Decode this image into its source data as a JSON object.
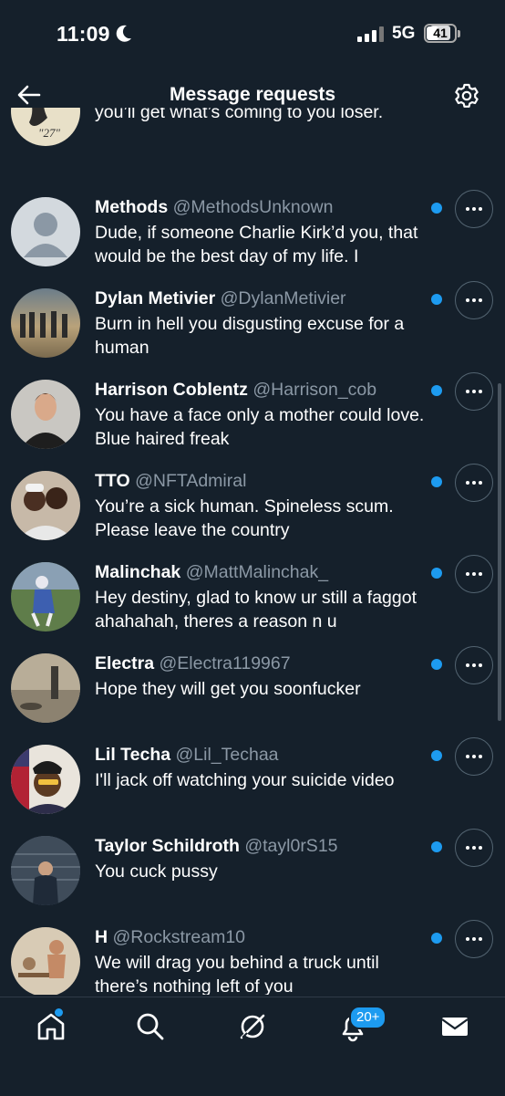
{
  "status_bar": {
    "time": "11:09",
    "network": "5G",
    "battery": "41"
  },
  "header": {
    "title": "Message requests"
  },
  "partial_row": {
    "handle_partial": "",
    "message": "you’ll get what’s coming to you loser."
  },
  "requests": [
    {
      "name": "Methods",
      "handle": "@MethodsUnknown",
      "message": "Dude, if someone Charlie Kirk’d you, that would be the best day of my life. I"
    },
    {
      "name": "Dylan Metivier",
      "handle": "@DylanMetivier",
      "message": "Burn in hell you disgusting excuse for a human"
    },
    {
      "name": "Harrison Coblentz",
      "handle": "@Harrison_cob",
      "message": "You have a face only a mother could love. Blue haired freak"
    },
    {
      "name": "TTO",
      "handle": "@NFTAdmiral",
      "message": "You’re a sick human. Spineless scum. Please leave the country"
    },
    {
      "name": "Malinchak",
      "handle": "@MattMalinchak_",
      "message": "Hey destiny, glad to know ur still a faggot ahahahah, theres a reason n u"
    },
    {
      "name": "Electra",
      "handle": "@Electra119967",
      "message": "Hope they will get you soonfucker"
    },
    {
      "name": "Lil Techa",
      "handle": "@Lil_Techaa",
      "message": "I'll jack off watching your suicide video"
    },
    {
      "name": "Taylor Schildroth",
      "handle": "@tayl0rS15",
      "message": "You cuck pussy"
    },
    {
      "name": "H",
      "handle": "@Rockstream10",
      "message": "We will drag you behind a truck until there’s nothing left of you"
    }
  ],
  "tabbar": {
    "notifications_badge": "20+"
  },
  "colors": {
    "background": "#15202b",
    "accent": "#1d9bf0",
    "secondary_text": "#8b98a5"
  }
}
